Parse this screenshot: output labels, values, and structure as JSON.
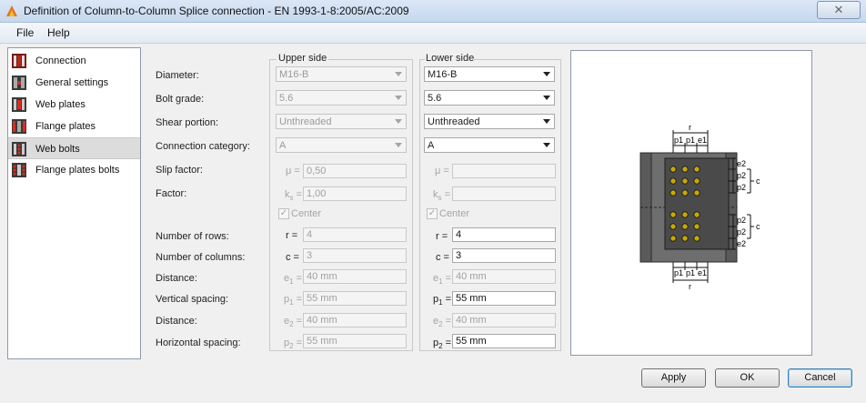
{
  "window": {
    "title": "Definition of Column-to-Column Splice connection - EN 1993-1-8:2005/AC:2009"
  },
  "menu": [
    "File",
    "Help"
  ],
  "nav": [
    {
      "label": "Connection",
      "icon": "connection-icon",
      "selected": false
    },
    {
      "label": "General settings",
      "icon": "general-settings-icon",
      "selected": false
    },
    {
      "label": "Web plates",
      "icon": "web-plates-icon",
      "selected": false
    },
    {
      "label": "Flange plates",
      "icon": "flange-plates-icon",
      "selected": false
    },
    {
      "label": "Web bolts",
      "icon": "web-bolts-icon",
      "selected": true
    },
    {
      "label": "Flange plates bolts",
      "icon": "flange-plates-bolts-icon",
      "selected": false
    }
  ],
  "groups": {
    "upper": "Upper side",
    "lower": "Lower side"
  },
  "labels": {
    "diameter": "Diameter:",
    "bolt_grade": "Bolt grade:",
    "shear_portion": "Shear portion:",
    "connection_category": "Connection category:",
    "slip_factor": "Slip factor:",
    "factor": "Factor:",
    "rows": "Number of rows:",
    "columns": "Number of columns:",
    "distance1": "Distance:",
    "vertical_spacing": "Vertical spacing:",
    "distance2": "Distance:",
    "horizontal_spacing": "Horizontal spacing:"
  },
  "symbols": {
    "mu": "μ =",
    "ks": "k",
    "ks_sub": "s",
    "eq": " =",
    "r": "r =",
    "c": "c =",
    "e": "e",
    "p": "p",
    "sub1": "1",
    "sub2": "2"
  },
  "center_label": "Center",
  "upper": {
    "diameter": "M16-B",
    "bolt_grade": "5.6",
    "shear_portion": "Unthreaded",
    "connection_category": "A",
    "slip_factor": "0,50",
    "factor": "1,00",
    "rows": "4",
    "columns": "3",
    "e1": "40 mm",
    "p1": "55 mm",
    "e2": "40 mm",
    "p2": "55 mm"
  },
  "lower": {
    "diameter": "M16-B",
    "bolt_grade": "5.6",
    "shear_portion": "Unthreaded",
    "connection_category": "A",
    "slip_factor": "",
    "factor": "",
    "rows": "4",
    "columns": "3",
    "e1": "40 mm",
    "p1": "55 mm",
    "e2": "40 mm",
    "p2": "55 mm"
  },
  "diagram": {
    "top_r": "r",
    "top_p1a": "p1",
    "top_p1b": "p1",
    "top_e1": "e1",
    "right_e2a": "e2",
    "right_p2a": "p2",
    "right_p2b": "p2",
    "right_ca": "c",
    "right_p2c": "p2",
    "right_p2d": "p2",
    "right_e2b": "e2",
    "right_cb": "c",
    "bot_p1a": "p1",
    "bot_p1b": "p1",
    "bot_e1": "e1",
    "bot_r": "r"
  },
  "buttons": {
    "apply": "Apply",
    "ok": "OK",
    "cancel": "Cancel"
  }
}
